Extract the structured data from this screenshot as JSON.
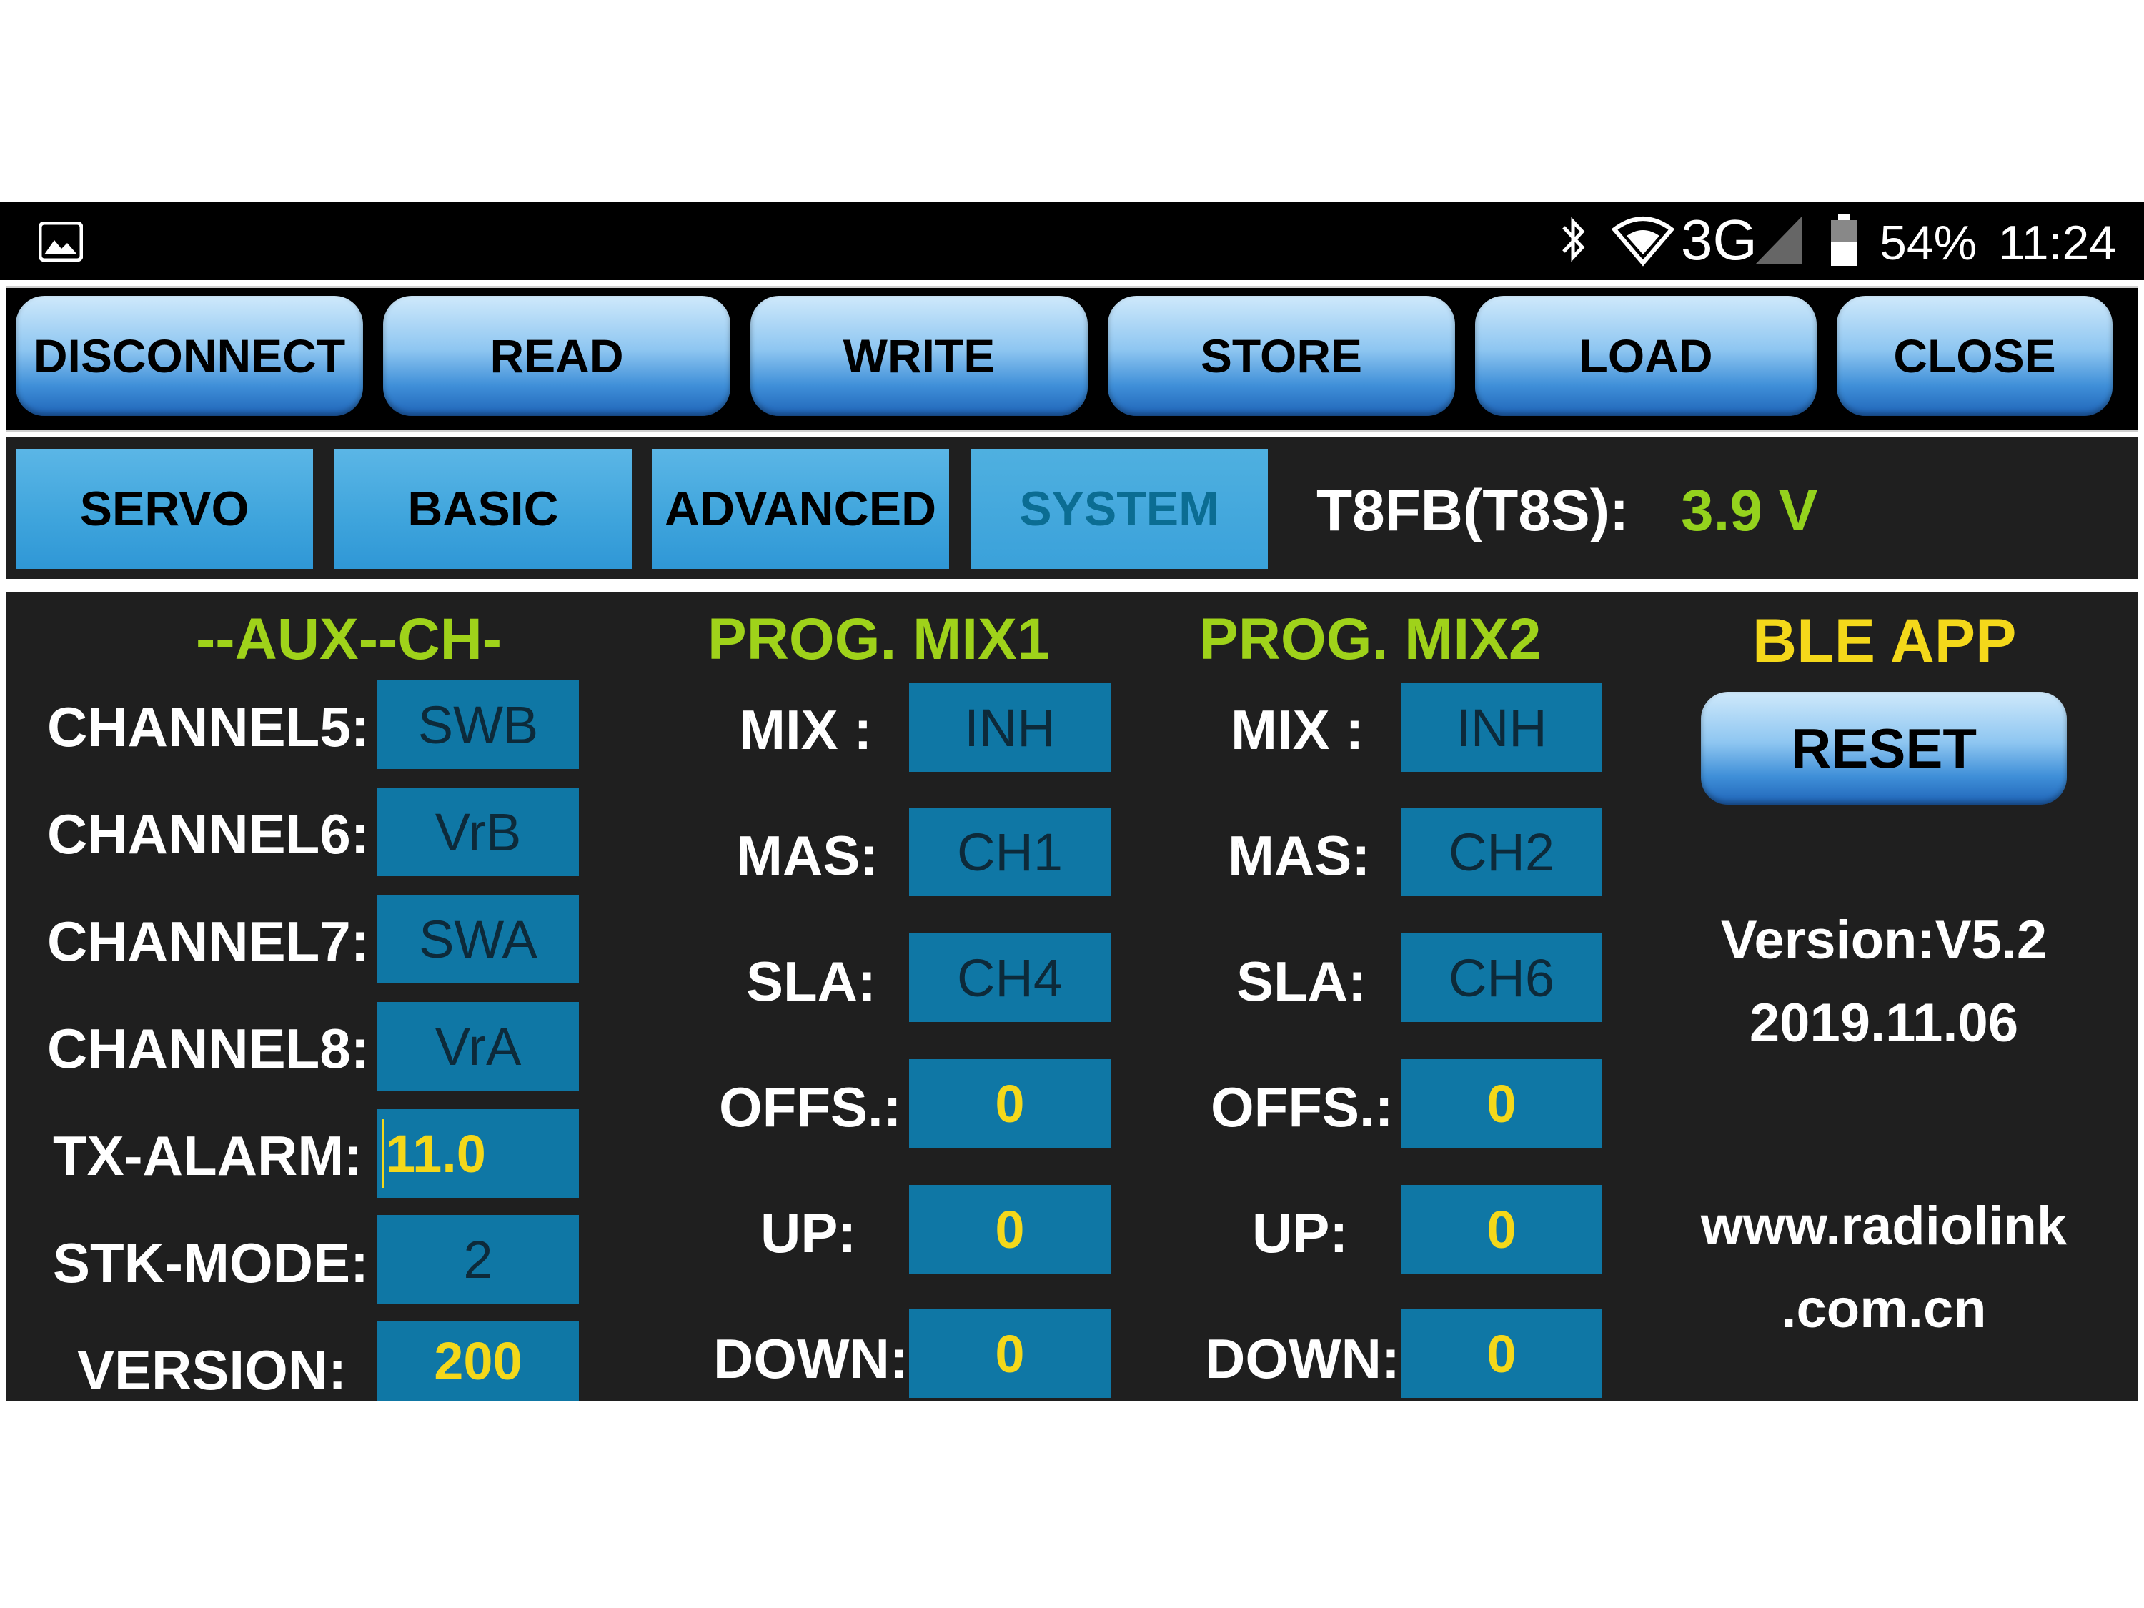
{
  "status_bar": {
    "network": "3G",
    "battery_percent": "54%",
    "time": "11:24",
    "icons": [
      "image-icon",
      "bluetooth-icon",
      "wifi-icon",
      "signal-icon",
      "battery-icon"
    ]
  },
  "toolbar": {
    "buttons": [
      "DISCONNECT",
      "READ",
      "WRITE",
      "STORE",
      "LOAD",
      "CLOSE"
    ]
  },
  "tabs": {
    "items": [
      "SERVO",
      "BASIC",
      "ADVANCED",
      "SYSTEM"
    ],
    "selected": "SYSTEM"
  },
  "receiver": {
    "label": "T8FB(T8S):",
    "voltage": "3.9 V"
  },
  "aux": {
    "title": "--AUX--CH-",
    "rows": [
      {
        "label": "CHANNEL5:",
        "value": "SWB"
      },
      {
        "label": "CHANNEL6:",
        "value": "VrB"
      },
      {
        "label": "CHANNEL7:",
        "value": "SWA"
      },
      {
        "label": "CHANNEL8:",
        "value": "VrA"
      },
      {
        "label": "TX-ALARM:",
        "value": "11.0"
      },
      {
        "label": "STK-MODE:",
        "value": "2"
      },
      {
        "label": "VERSION:",
        "value": "200"
      }
    ]
  },
  "mix1": {
    "title": "PROG. MIX1",
    "rows": [
      {
        "label": "MIX :",
        "value": "INH"
      },
      {
        "label": "MAS:",
        "value": "CH1"
      },
      {
        "label": "SLA:",
        "value": "CH4"
      },
      {
        "label": "OFFS.:",
        "value": "0"
      },
      {
        "label": "UP:",
        "value": "0"
      },
      {
        "label": "DOWN:",
        "value": "0"
      }
    ]
  },
  "mix2": {
    "title": "PROG. MIX2",
    "rows": [
      {
        "label": "MIX :",
        "value": "INH"
      },
      {
        "label": "MAS:",
        "value": "CH2"
      },
      {
        "label": "SLA:",
        "value": "CH6"
      },
      {
        "label": "OFFS.:",
        "value": "0"
      },
      {
        "label": "UP:",
        "value": "0"
      },
      {
        "label": "DOWN:",
        "value": "0"
      }
    ]
  },
  "ble": {
    "title": "BLE APP",
    "reset_label": "RESET",
    "version_line": "Version:V5.2",
    "date_line": "2019.11.06",
    "url_line1": "www.radiolink",
    "url_line2": ".com.cn"
  },
  "colors": {
    "accent_green": "#9fd21a",
    "accent_yellow": "#f4d81a",
    "field_blue": "#0f77a5",
    "tab_blue": "#3ea4dc"
  }
}
